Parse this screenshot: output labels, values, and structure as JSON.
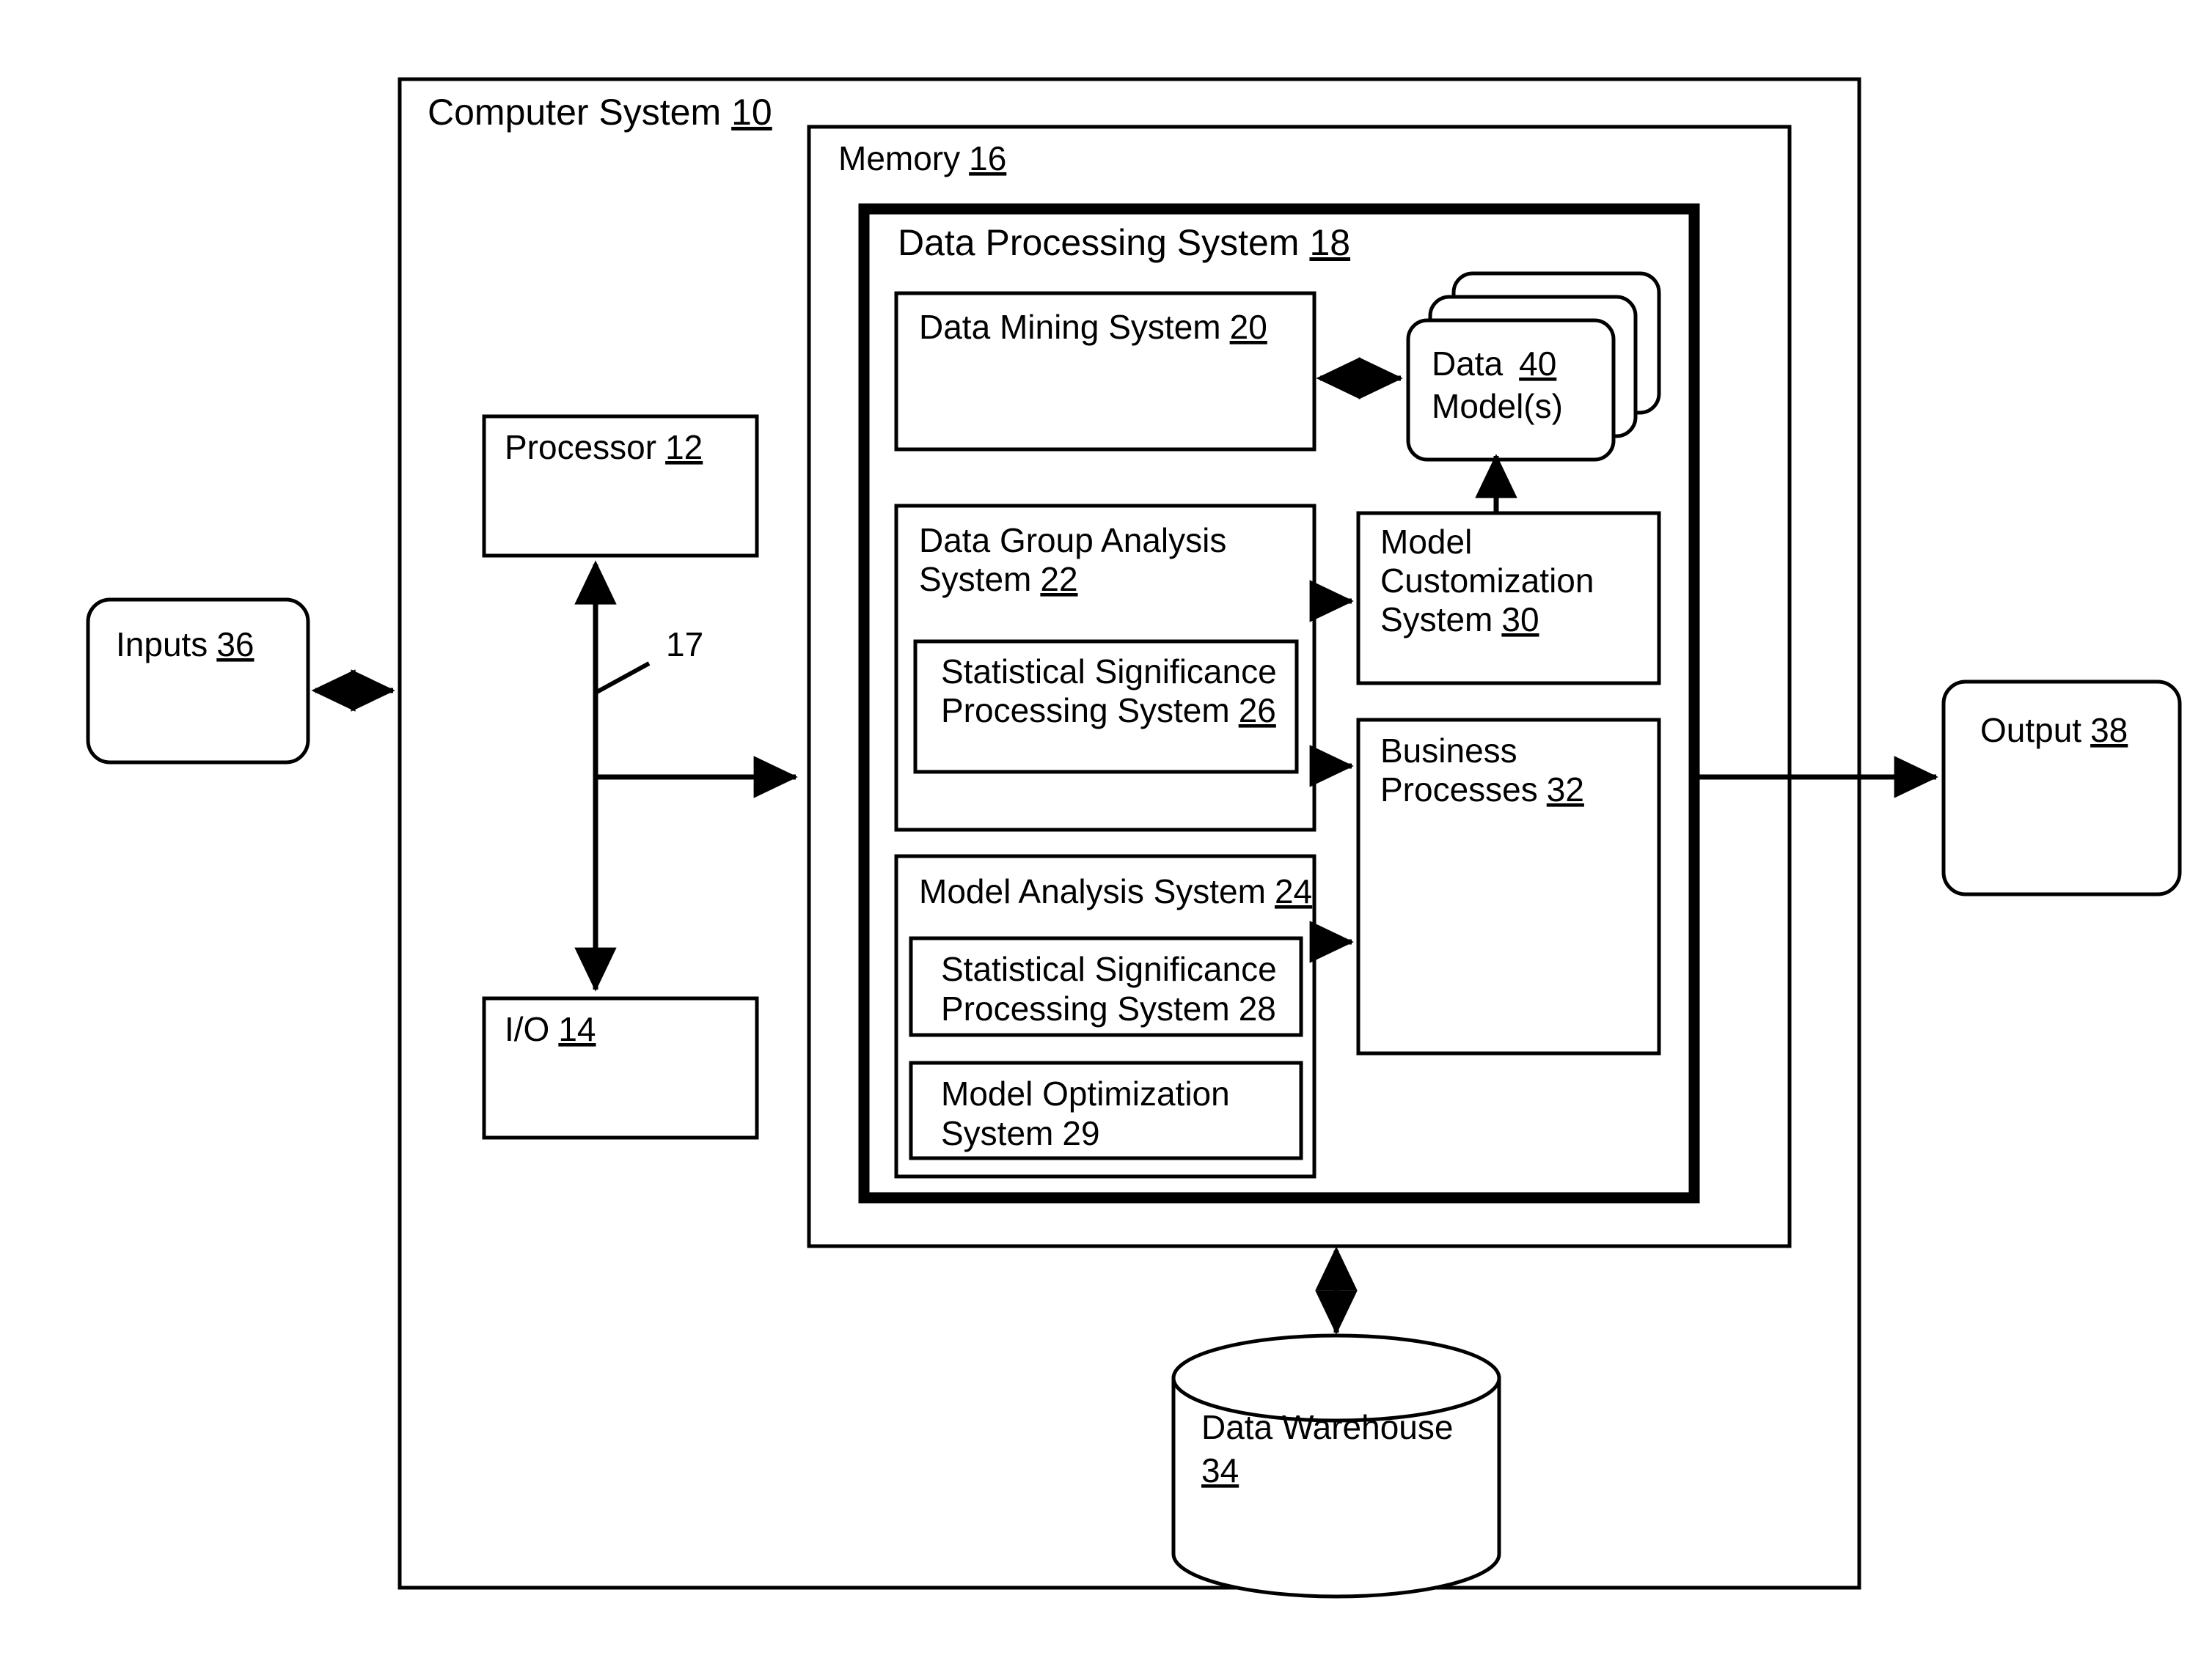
{
  "figure": {
    "type": "patent-block-diagram",
    "background_color": "#ffffff",
    "line_color": "#000000"
  },
  "containers": {
    "computer_system": {
      "label": "Computer System",
      "ref": "10",
      "ref_underlined": true
    },
    "memory": {
      "label": "Memory",
      "ref": "16",
      "ref_underlined": true
    },
    "data_processing_system": {
      "label": "Data Processing System",
      "ref": "18",
      "ref_underlined": true
    }
  },
  "blocks": {
    "processor": {
      "label": "Processor",
      "ref": "12",
      "ref_underlined": true
    },
    "io": {
      "label": "I/O",
      "ref": "14",
      "ref_underlined": true
    },
    "bus": {
      "ref": "17",
      "ref_underlined": false
    },
    "data_mining_system": {
      "label": "Data Mining System",
      "ref": "20",
      "ref_underlined": true
    },
    "data_models": {
      "line1_label": "Data",
      "line1_ref": "40",
      "line1_ref_underlined": true,
      "line2_label": "Model(s)",
      "stack_count": 3
    },
    "data_group_analysis_system": {
      "line1": "Data Group Analysis",
      "line2": "System",
      "ref": "22",
      "ref_underlined": true
    },
    "statistical_significance_26": {
      "line1": "Statistical Significance",
      "line2": "Processing System",
      "ref": "26",
      "ref_underlined": true
    },
    "model_analysis_system": {
      "label": "Model Analysis System",
      "ref": "24",
      "ref_underlined": true
    },
    "statistical_significance_28": {
      "line1": "Statistical Significance",
      "line2": "Processing System",
      "ref": "28",
      "ref_underlined": false
    },
    "model_optimization_system": {
      "line1": "Model Optimization",
      "line2": "System",
      "ref": "29",
      "ref_underlined": false
    },
    "model_customization_system": {
      "line1": "Model",
      "line2": "Customization",
      "line3": "System",
      "ref": "30",
      "ref_underlined": true
    },
    "business_processes": {
      "line1": "Business",
      "line2": "Processes",
      "ref": "32",
      "ref_underlined": true
    },
    "data_warehouse": {
      "line1": "Data Warehouse",
      "line2_ref": "34",
      "ref_underlined": true
    },
    "inputs": {
      "label": "Inputs",
      "ref": "36",
      "ref_underlined": true
    },
    "output": {
      "label": "Output",
      "ref": "38",
      "ref_underlined": true
    }
  },
  "connectors": [
    {
      "name": "inputs-to-computer-system",
      "style": "double-arrow",
      "orientation": "horizontal"
    },
    {
      "name": "processor-to-io-bus",
      "style": "double-arrow",
      "orientation": "vertical"
    },
    {
      "name": "bus-to-memory",
      "style": "single-arrow",
      "orientation": "horizontal"
    },
    {
      "name": "data-mining-to-data-models",
      "style": "double-arrow",
      "orientation": "horizontal"
    },
    {
      "name": "data-group-analysis-to-model-customization",
      "style": "single-arrow",
      "orientation": "horizontal"
    },
    {
      "name": "data-group-analysis-to-business-processes",
      "style": "single-arrow",
      "orientation": "horizontal"
    },
    {
      "name": "model-analysis-to-business-processes",
      "style": "single-arrow",
      "orientation": "horizontal"
    },
    {
      "name": "model-customization-to-data-models",
      "style": "single-arrow",
      "orientation": "vertical-up"
    },
    {
      "name": "business-processes-to-output",
      "style": "single-arrow",
      "orientation": "horizontal"
    },
    {
      "name": "memory-to-data-warehouse",
      "style": "double-arrow",
      "orientation": "vertical"
    }
  ]
}
